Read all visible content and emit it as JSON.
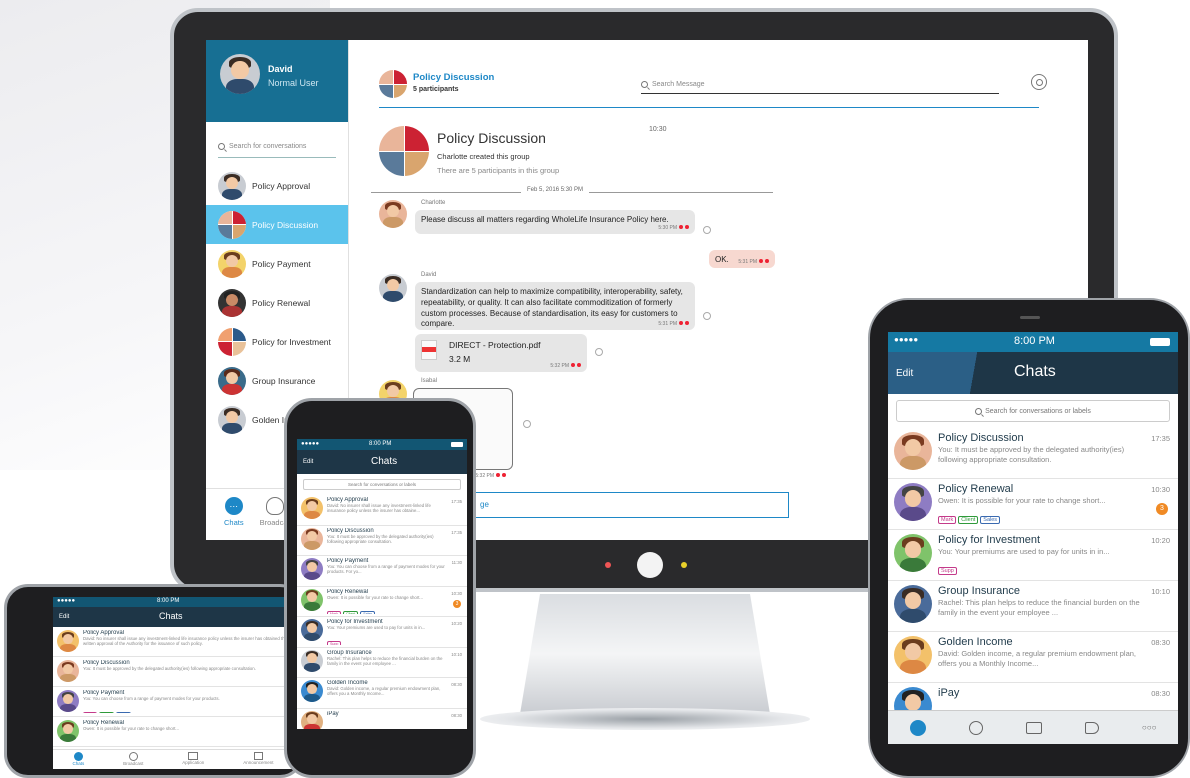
{
  "desktop": {
    "user": {
      "name": "David",
      "role": "Normal User"
    },
    "search_placeholder": "Search for conversations",
    "conversations": [
      {
        "label": "Policy Approval"
      },
      {
        "label": "Policy Discussion"
      },
      {
        "label": "Policy Payment"
      },
      {
        "label": "Policy Renewal"
      },
      {
        "label": "Policy for Investment"
      },
      {
        "label": "Group Insurance"
      },
      {
        "label": "Golden In"
      }
    ],
    "footer": {
      "chats": "Chats",
      "broadcast": "Broadcas"
    },
    "header": {
      "title": "Policy Discussion",
      "participants": "5 participants",
      "search_placeholder": "Search Message"
    },
    "info": {
      "title": "Policy Discussion",
      "created": "Charlotte created this group",
      "count": "There are 5 participants in this group",
      "time": "10:30"
    },
    "date_divider": "Feb 5, 2016 5:30 PM",
    "messages": {
      "m1_sender": "Charlotte",
      "m1_text": "Please discuss all matters regarding WholeLife Insurance Policy here.",
      "m1_time": "5:30 PM",
      "m2_text": "OK.",
      "m2_time": "5:31 PM",
      "m3_sender": "David",
      "m3_text": "Standardization can help to maximize compatibility, interoperability, safety, repeatability, or quality. It can also facilitate commoditization of formerly custom processes. Because of standardisation, its easy for customers to compare.",
      "m3_time": "5:31 PM",
      "file_name": "DIRECT - Protection.pdf",
      "file_size": "3.2 M",
      "file_time": "5:32 PM",
      "m4_sender": "Isabal",
      "m4_time": "5:32 PM"
    },
    "compose_placeholder": "ge"
  },
  "bigphone": {
    "status_time": "8:00 PM",
    "signal": "●●●●●",
    "edit": "Edit",
    "title": "Chats",
    "search": "Search for conversations or labels",
    "rows": [
      {
        "title_a": "Policy ",
        "title_b": "Discussion",
        "preview": "You: It must be approved by the delegated authority(ies) following appropriate consultation.",
        "time": "17:35"
      },
      {
        "title_a": "Policy ",
        "title_b": "Renewal",
        "preview": "Owen: It is possible for your rate to change short...",
        "time": "10:30",
        "badge": "3",
        "tags": [
          "Mark",
          "Client",
          "Sales"
        ]
      },
      {
        "title_a": "Policy for ",
        "title_b": "Investment",
        "preview": "You: Your premiums are used to pay for units in in...",
        "time": "10:20",
        "tags": [
          "Supp"
        ]
      },
      {
        "title_a": "Group ",
        "title_b": "Insurance",
        "preview": "Rachel: This plan helps to reduce the financial burden on the family in the event your employee ...",
        "time": "10:10"
      },
      {
        "title_a": "Golden ",
        "title_b": "Income",
        "preview": "David: Golden income, a regular premium endowment plan, offers you a Monthly Income...",
        "time": "08:30"
      },
      {
        "title_a": "iPay",
        "title_b": "",
        "preview": "",
        "time": "08:30"
      }
    ],
    "more": "○○○"
  },
  "smallphone": {
    "status_time": "8:00 PM",
    "signal": "●●●●●",
    "edit": "Edit",
    "title": "Chats",
    "search": "Search for conversations or labels",
    "rows": [
      {
        "title": "Policy Approval",
        "preview": "David: No insurer shall issue any investment-linked life insurance policy unless the insurer has obtaine...",
        "time": "17:35"
      },
      {
        "title": "Policy Discussion",
        "preview": "You: It must be approved by the delegated authority(ies) following appropriate consultation.",
        "time": "17:35"
      },
      {
        "title": "Policy Payment",
        "preview": "You: You can choose from a range of payment modes for your products. For yo...",
        "time": "11:30"
      },
      {
        "title": "Policy Renewal",
        "preview": "Owen: It is possible for your rate to change short...",
        "time": "10:30",
        "badge": "3",
        "tags": [
          "Mark",
          "Client",
          "Sales"
        ]
      },
      {
        "title": "Policy for Investment",
        "preview": "You: Your premiums are used to pay for units in in...",
        "time": "10:20",
        "tags": [
          "Supp"
        ]
      },
      {
        "title": "Group Insurance",
        "preview": "Rachel: This plan helps to reduce the financial burden on the family in the event your employee ...",
        "time": "10:10"
      },
      {
        "title": "Golden Income",
        "preview": "David: Golden income, a regular premium endowment plan, offers you a Monthly Income...",
        "time": "08:30"
      },
      {
        "title": "iPay",
        "preview": "",
        "time": "08:30"
      }
    ]
  },
  "tablet": {
    "status_time": "8:00 PM",
    "signal": "●●●●●",
    "edit": "Edit",
    "title": "Chats",
    "rows": [
      {
        "title": "Policy Approval",
        "preview": "David: No insurer shall issue any investment-linked life insurance policy unless the insurer has obtained the written approval of the Authority for the issuance of such policy."
      },
      {
        "title": "Policy Discussion",
        "preview": "You: It must be approved by the delegated authority(ies) following appropriate consultation."
      },
      {
        "title": "Policy Payment",
        "preview": "You: You can choose from a range of payment modes for your products.",
        "tags": [
          "Mark",
          "Client",
          "Sales"
        ]
      },
      {
        "title": "Policy Renewal",
        "preview": "Owen: It is possible for your rate to change short..."
      }
    ],
    "tabs": {
      "chats": "Chats",
      "broadcast": "Broadcast",
      "application": "Application",
      "announcement": "Announcement"
    }
  },
  "colors": {
    "accent": "#1e88c7",
    "header": "#176f93",
    "nav": "#1e3647",
    "active": "#5bc3ec",
    "badge": "#f08a24"
  }
}
